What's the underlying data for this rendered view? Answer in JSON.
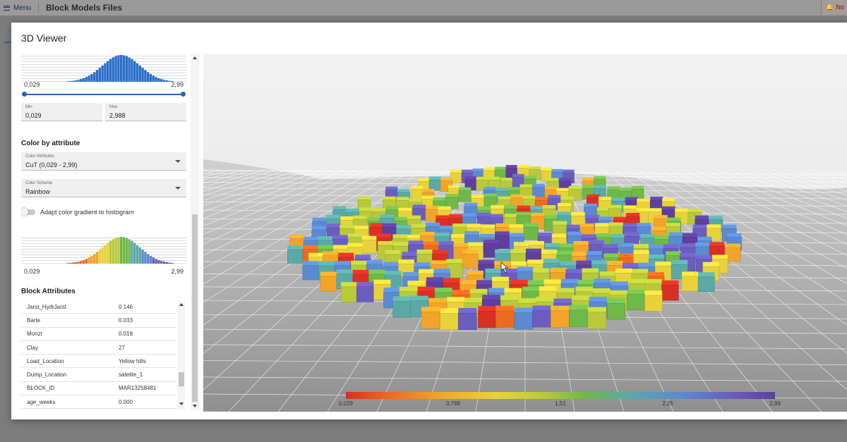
{
  "app": {
    "menu_label": "Menu",
    "page_title": "Block Models Files",
    "notification_label": "No"
  },
  "modal": {
    "title": "3D Viewer"
  },
  "filter": {
    "hist_min_label": "0,029",
    "hist_max_label": "2,99",
    "min_field_label": "Min",
    "min_value": "0,029",
    "max_field_label": "Max",
    "max_value": "2,988"
  },
  "color_by": {
    "heading": "Color by attribute",
    "attribute_label": "Color Attributes",
    "attribute_value": "CuT (0,029 - 2,99)",
    "scheme_label": "Color Scheme",
    "scheme_value": "Rainbow",
    "adapt_label": "Adapt color gradient to histogram",
    "adapt_enabled": false,
    "hist_min_label": "0,029",
    "hist_max_label": "2,99"
  },
  "block_attributes": {
    "heading": "Block Attributes",
    "rows": [
      {
        "key": "Jarst_HydrJarst",
        "value": "0.146"
      },
      {
        "key": "Barte",
        "value": "0.033"
      },
      {
        "key": "Monzt",
        "value": "0.018"
      },
      {
        "key": "Clay",
        "value": "27"
      },
      {
        "key": "Load_Location",
        "value": "Yellow hills"
      },
      {
        "key": "Dump_Location",
        "value": "satelite_1"
      },
      {
        "key": "BLOCK_ID",
        "value": "MAR13258481"
      },
      {
        "key": "age_weeks",
        "value": "0.000"
      }
    ]
  },
  "legend": {
    "ticks": [
      "0,029",
      "0,769",
      "1,51",
      "2,25",
      "2,99"
    ],
    "colors": [
      "#d73024",
      "#ee6a1f",
      "#f2a42a",
      "#e8d23c",
      "#b9c93a",
      "#6fb84a",
      "#5aa9a6",
      "#5b8ad0",
      "#6a5dbe",
      "#5e3f9e"
    ]
  }
}
